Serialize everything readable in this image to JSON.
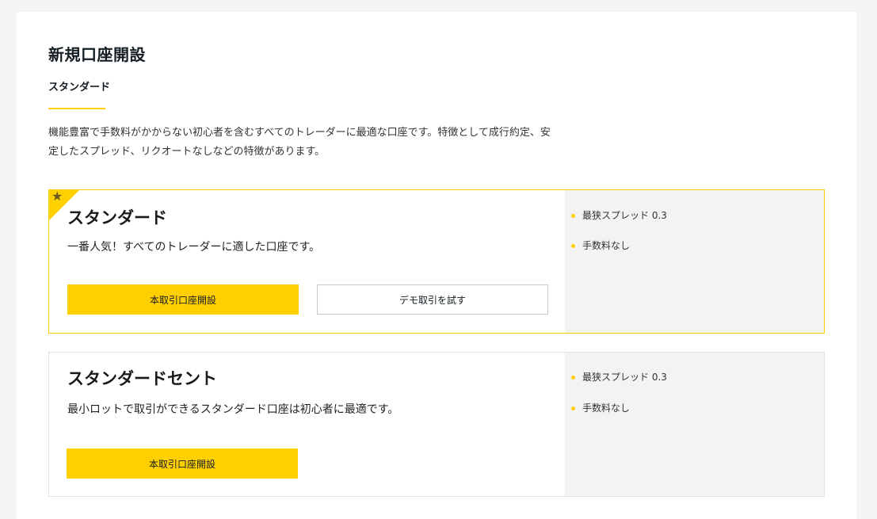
{
  "page": {
    "title": "新規口座開設",
    "tab_label": "スタンダード",
    "intro_line1": "機能豊富で手数料がかからない初心者を含むすべてのトレーダーに最適な口座です。特徴として成行約定、安",
    "intro_line2": "定したスプレッド、リクオートなしなどの特徴があります。"
  },
  "cards": [
    {
      "title": "スタンダード",
      "description": "一番人気！すべてのトレーダーに適した口座です。",
      "primary_button": "本取引口座開設",
      "secondary_button": "デモ取引を試す",
      "badge_icon": "star-icon",
      "features": [
        "最狭スプレッド 0.3",
        "手数料なし"
      ]
    },
    {
      "title": "スタンダードセント",
      "description": "最小ロットで取引ができるスタンダード口座は初心者に最適です。",
      "primary_button": "本取引口座開設",
      "features": [
        "最狭スプレッド 0.3",
        "手数料なし"
      ]
    }
  ],
  "colors": {
    "accent": "#ffcf00",
    "background": "#f3f4f5",
    "feature_panel": "#f3f3f3"
  }
}
